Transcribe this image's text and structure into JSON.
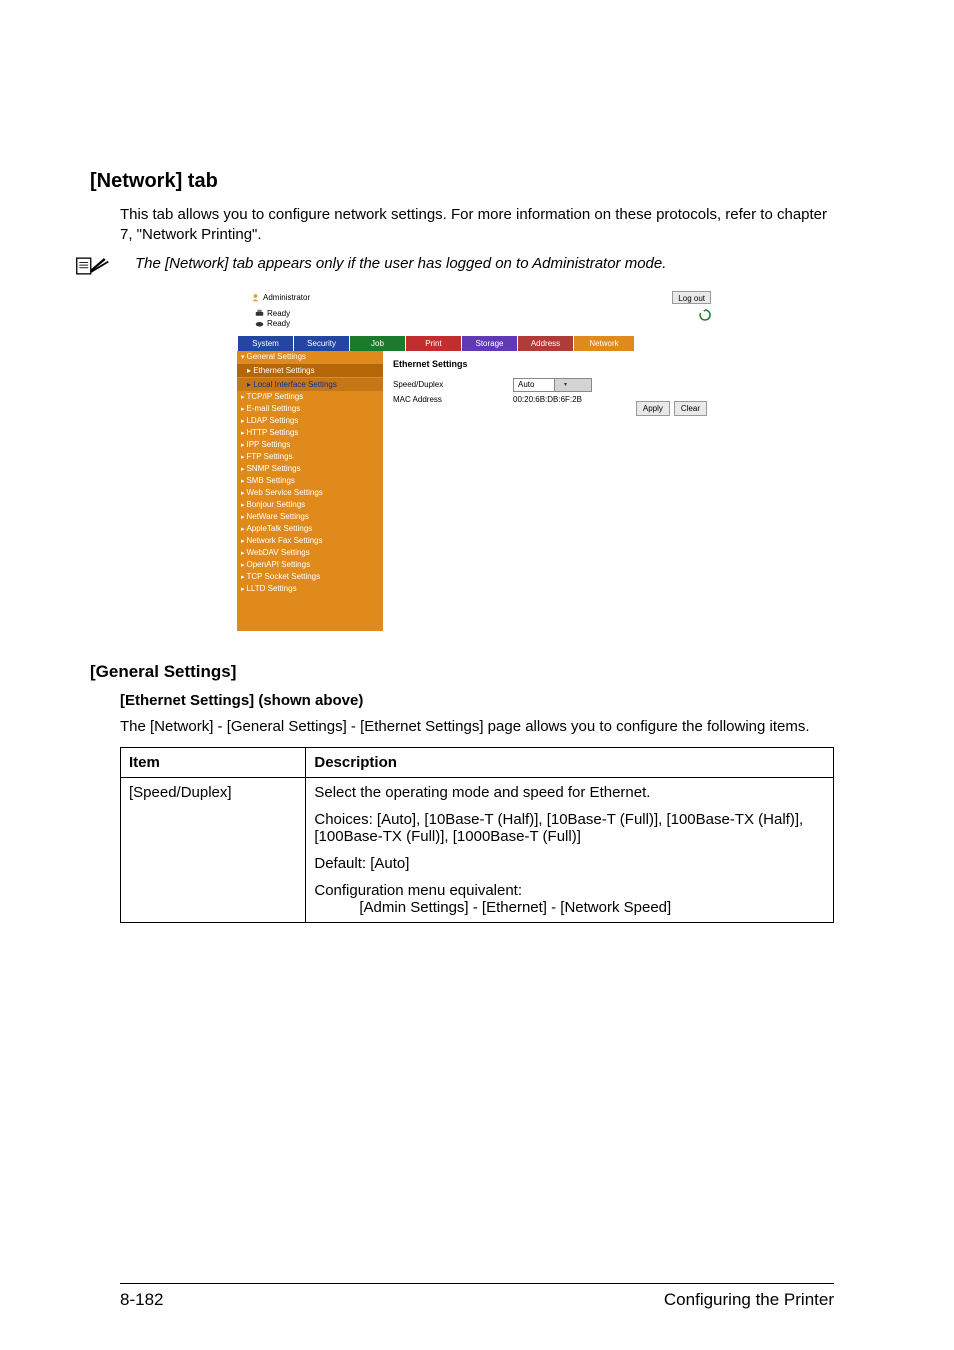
{
  "headings": {
    "h1": "[Network] tab",
    "h2": "[General Settings]",
    "h3": "[Ethernet Settings] (shown above)"
  },
  "intro": "This tab allows you to configure network settings. For more information on these protocols, refer to chapter 7, \"Network Printing\".",
  "note": "The [Network] tab appears only if the user has logged on to Administrator mode.",
  "screenshot": {
    "user_label": "Administrator",
    "logout_btn": "Log out",
    "status1": "Ready",
    "status2": "Ready",
    "tabs": [
      "System",
      "Security",
      "Job",
      "Print",
      "Storage",
      "Address",
      "Network"
    ],
    "sidebar": {
      "group0": "General Settings",
      "sub0": "Ethernet Settings",
      "sub1": "Local Interface Settings",
      "items": [
        "TCP/IP Settings",
        "E-mail Settings",
        "LDAP Settings",
        "HTTP Settings",
        "IPP Settings",
        "FTP Settings",
        "SNMP Settings",
        "SMB Settings",
        "Web Service Settings",
        "Bonjour Settings",
        "NetWare Settings",
        "AppleTalk Settings",
        "Network Fax Settings",
        "WebDAV Settings",
        "OpenAPI Settings",
        "TCP Socket Settings",
        "LLTD Settings"
      ]
    },
    "content": {
      "title": "Ethernet Settings",
      "speed_label": "Speed/Duplex",
      "speed_value": "Auto",
      "mac_label": "MAC Address",
      "mac_value": "00:20:6B:DB:6F:2B",
      "apply": "Apply",
      "clear": "Clear"
    }
  },
  "table_lead": "The [Network] - [General Settings] - [Ethernet Settings] page allows you to configure the following items.",
  "table": {
    "head_item": "Item",
    "head_desc": "Description",
    "row1_item": "[Speed/Duplex]",
    "row1_l1": "Select the operating mode and speed for Ethernet.",
    "row1_l2": "Choices: [Auto], [10Base-T (Half)], [10Base-T (Full)], [100Base-TX (Half)], [100Base-TX (Full)], [1000Base-T (Full)]",
    "row1_l3": "Default: [Auto]",
    "row1_l4": "Configuration menu equivalent:",
    "row1_l5": "[Admin Settings] - [Ethernet] - [Network Speed]"
  },
  "footer": {
    "page": "8-182",
    "title": "Configuring the Printer"
  }
}
